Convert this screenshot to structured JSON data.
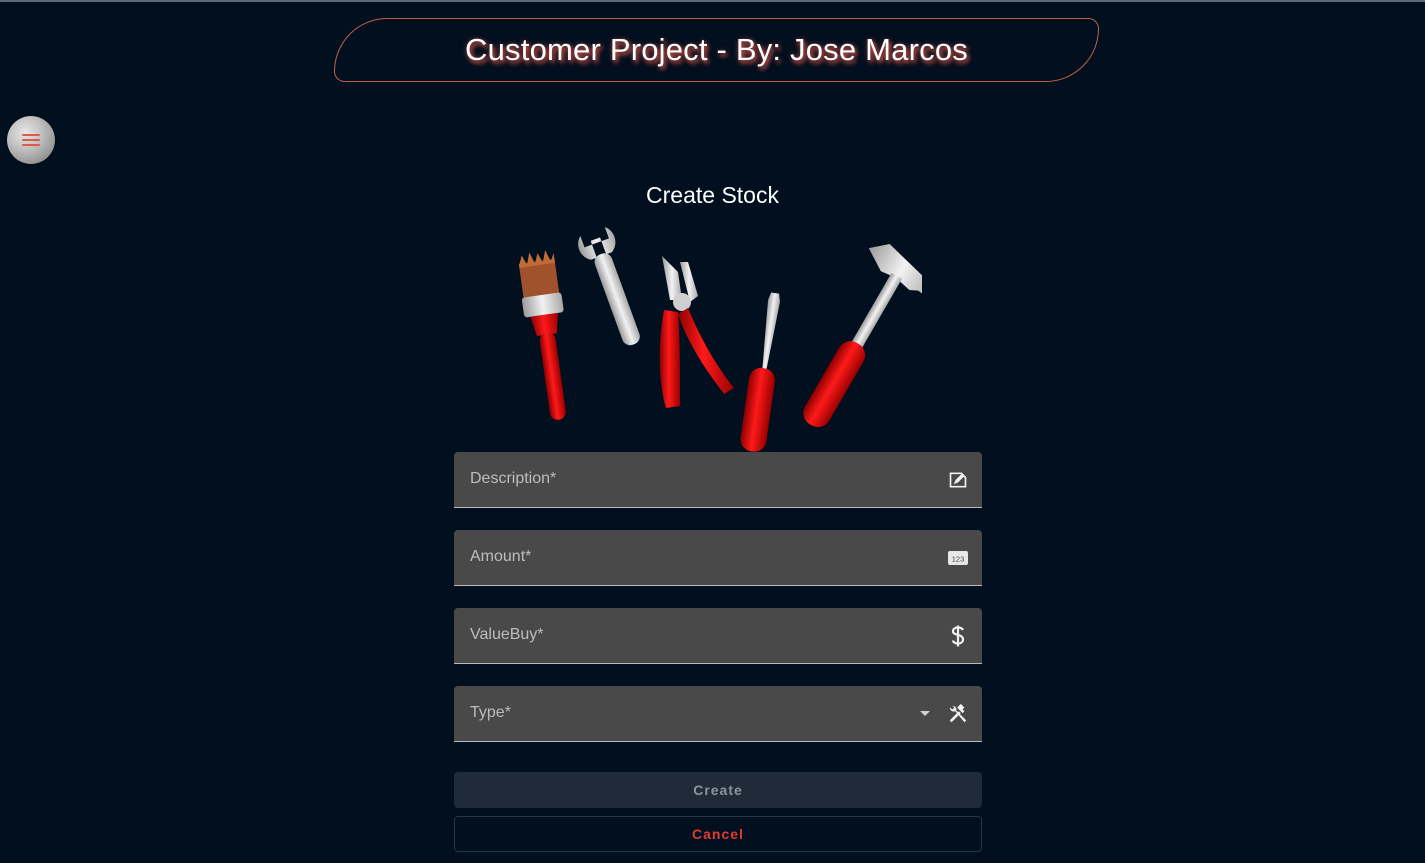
{
  "header": {
    "title": "Customer Project - By: Jose Marcos"
  },
  "menu_button": {
    "icon": "menu-icon"
  },
  "page": {
    "heading": "Create Stock",
    "illustration": "tools-illustration"
  },
  "form": {
    "fields": [
      {
        "label": "Description*",
        "value": "",
        "icon": "edit-document-icon"
      },
      {
        "label": "Amount*",
        "value": "",
        "icon": "numbers-123-icon"
      },
      {
        "label": "ValueBuy*",
        "value": "",
        "icon": "dollar-icon"
      },
      {
        "label": "Type*",
        "value": "",
        "icon": "tools-icon",
        "has_dropdown": true
      }
    ],
    "create_label": "Create",
    "cancel_label": "Cancel"
  },
  "colors": {
    "background": "#010f1e",
    "accent": "#e23b30",
    "field_bg": "#4a4949"
  }
}
